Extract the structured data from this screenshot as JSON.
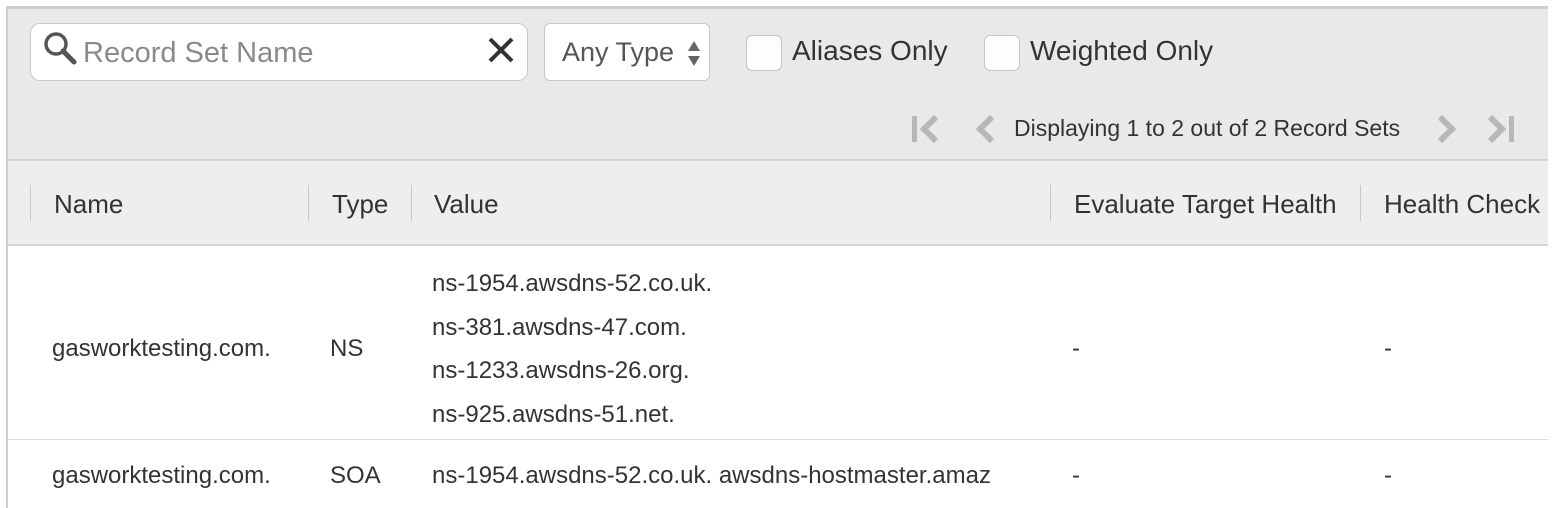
{
  "search": {
    "placeholder": "Record Set Name",
    "value": ""
  },
  "type_filter": {
    "selected": "Any Type"
  },
  "filters": {
    "aliases_only": "Aliases Only",
    "weighted_only": "Weighted Only"
  },
  "pagination": {
    "status": "Displaying 1 to 2 out of 2 Record Sets"
  },
  "table": {
    "columns": [
      "Name",
      "Type",
      "Value",
      "Evaluate Target Health",
      "Health Check I"
    ],
    "rows": [
      {
        "name": "gasworktesting.com.",
        "type": "NS",
        "values": [
          "ns-1954.awsdns-52.co.uk.",
          "ns-381.awsdns-47.com.",
          "ns-1233.awsdns-26.org.",
          "ns-925.awsdns-51.net."
        ],
        "evaluate_target_health": "-",
        "health_check": "-"
      },
      {
        "name": "gasworktesting.com.",
        "type": "SOA",
        "values": [
          "ns-1954.awsdns-52.co.uk. awsdns-hostmaster.amaz"
        ],
        "evaluate_target_health": "-",
        "health_check": "-"
      }
    ]
  },
  "colors": {
    "toolbar_bg": "#e9e9e9",
    "header_bg": "#eeeeee",
    "disabled_icon": "#b5b5b5"
  }
}
